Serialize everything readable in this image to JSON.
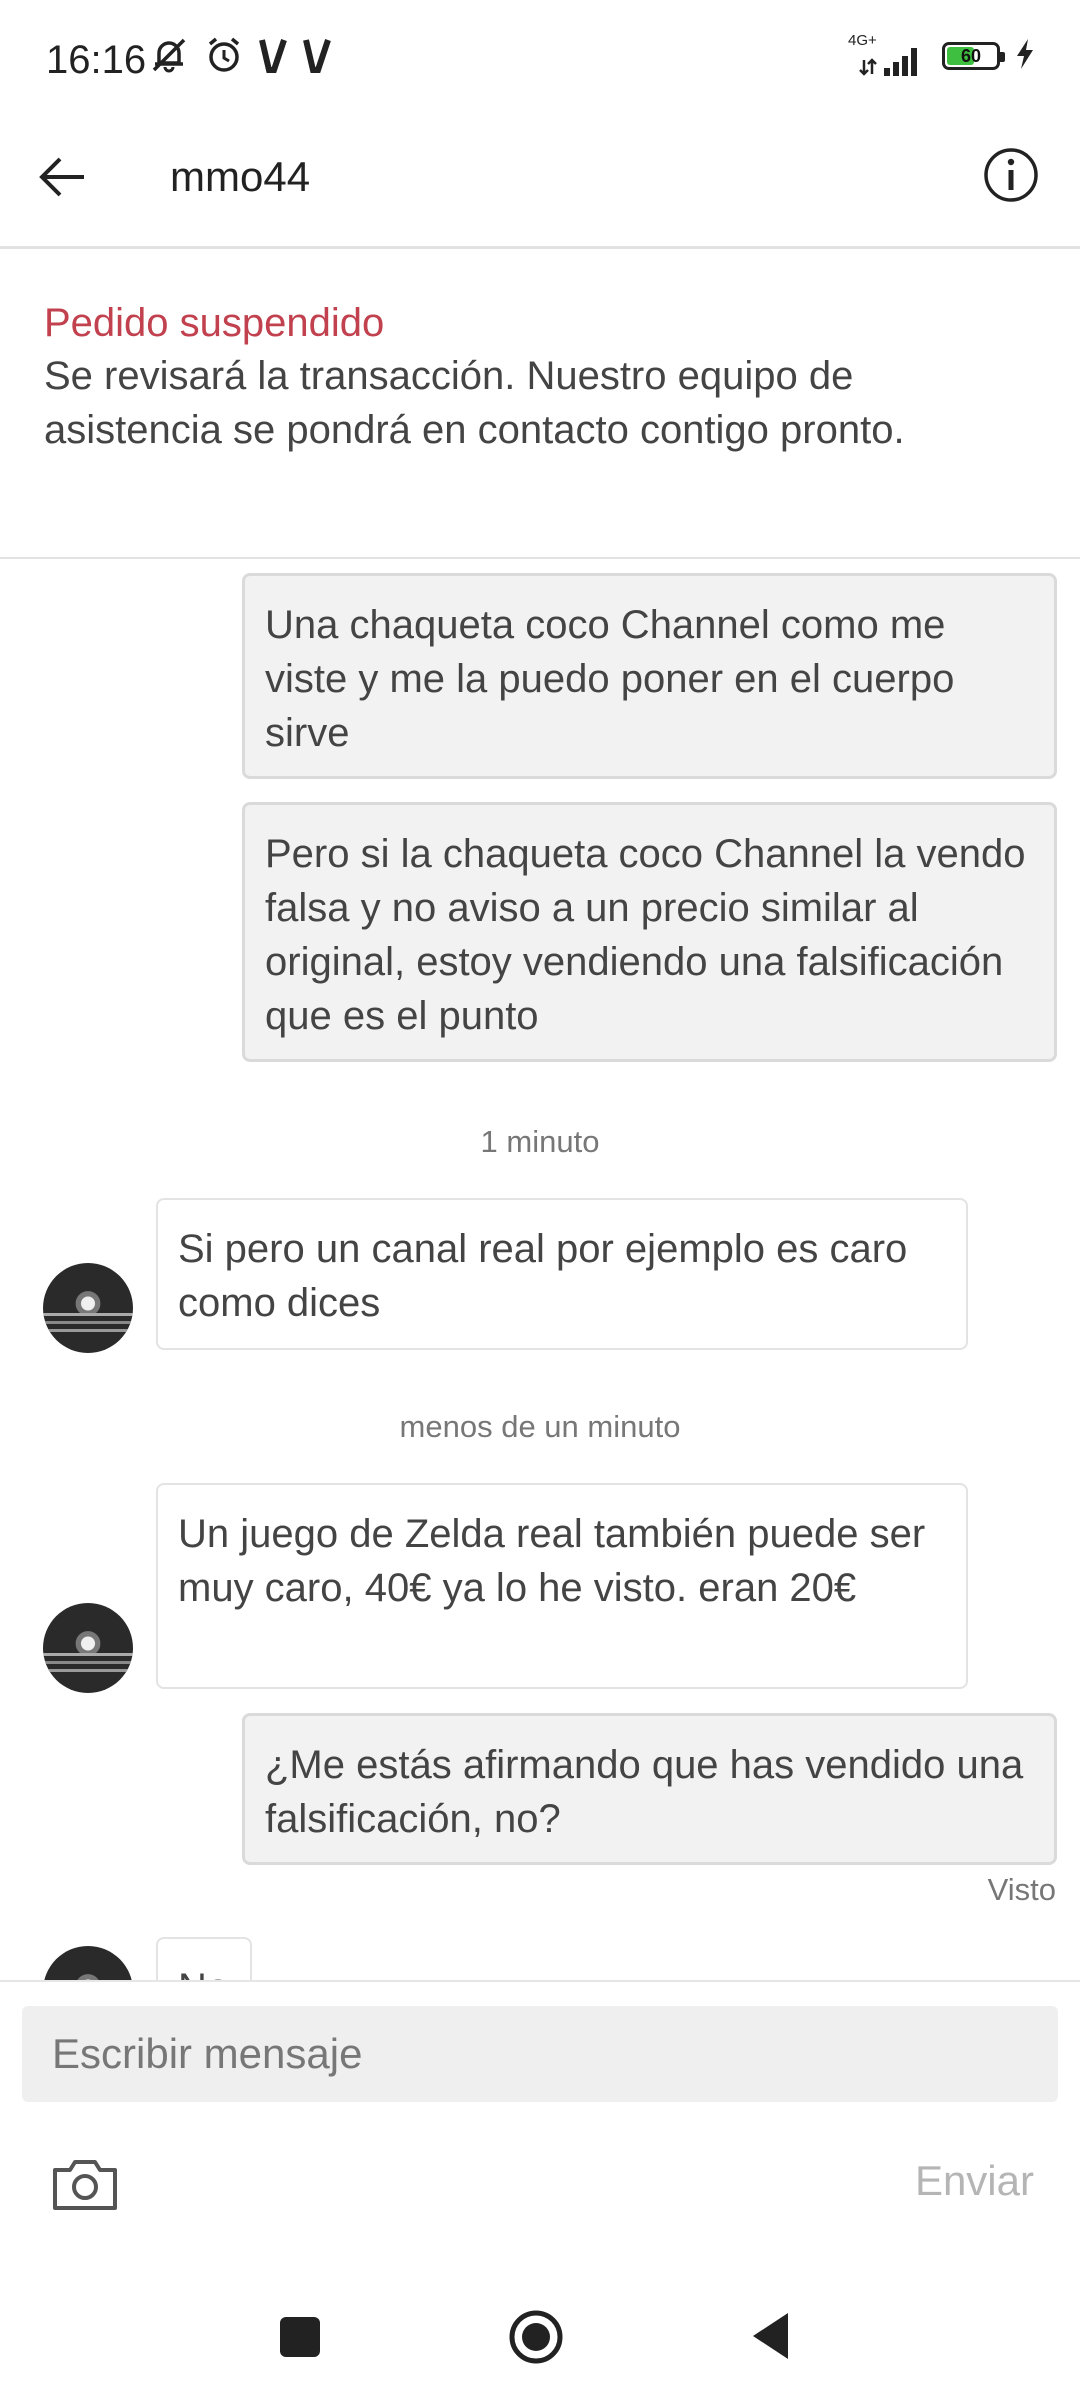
{
  "status_bar": {
    "time": "16:16",
    "network": "4G+",
    "battery": "60",
    "battery_level": 0.6,
    "icons": [
      "muted-bell-icon",
      "alarm-icon",
      "v-icon",
      "v-icon",
      "signal-icon",
      "battery-icon",
      "charging-icon"
    ]
  },
  "header": {
    "title": "mmo44",
    "back_icon": "arrow-left-icon",
    "info_icon": "info-icon"
  },
  "banner": {
    "title": "Pedido suspendido",
    "text": "Se revisará la transacción. Nuestro equipo de asistencia se pondrá en contacto contigo pronto."
  },
  "messages": [
    {
      "direction": "out",
      "text": "Una chaqueta coco Channel como me viste y me la puedo poner en el cuerpo sirve"
    },
    {
      "direction": "out",
      "text": "Pero si la chaqueta coco Channel la vendo falsa y no aviso a un precio similar al original, estoy vendiendo una falsificación que es el punto"
    },
    {
      "type": "time",
      "text": "1 minuto"
    },
    {
      "direction": "in",
      "text": "Si pero un canal real por ejemplo es caro como dices"
    },
    {
      "type": "time",
      "text": "menos de un minuto"
    },
    {
      "direction": "in",
      "text": "Un juego de Zelda real también puede ser muy caro, 40€ ya lo he visto. eran 20€"
    },
    {
      "direction": "out",
      "text": "¿Me estás afirmando que has vendido una falsificación, no?"
    },
    {
      "type": "seen",
      "text": "Visto"
    },
    {
      "direction": "in",
      "text": "No"
    }
  ],
  "composer": {
    "placeholder": "Escribir mensaje",
    "camera_icon": "camera-icon",
    "send_label": "Enviar"
  },
  "colors": {
    "accent_red": "#c1414e",
    "send_disabled": "#b5b5b5"
  }
}
